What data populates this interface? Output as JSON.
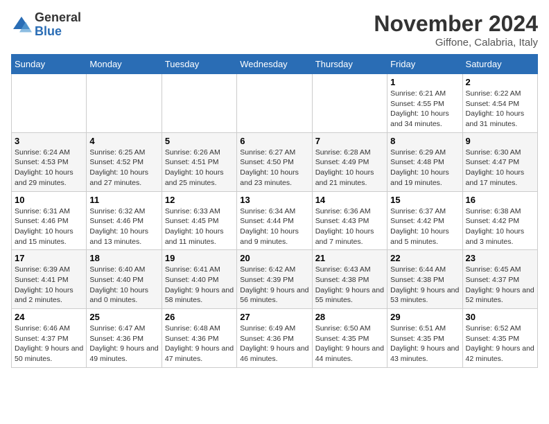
{
  "logo": {
    "general": "General",
    "blue": "Blue"
  },
  "title": "November 2024",
  "location": "Giffone, Calabria, Italy",
  "weekdays": [
    "Sunday",
    "Monday",
    "Tuesday",
    "Wednesday",
    "Thursday",
    "Friday",
    "Saturday"
  ],
  "weeks": [
    [
      {
        "day": "",
        "info": ""
      },
      {
        "day": "",
        "info": ""
      },
      {
        "day": "",
        "info": ""
      },
      {
        "day": "",
        "info": ""
      },
      {
        "day": "",
        "info": ""
      },
      {
        "day": "1",
        "info": "Sunrise: 6:21 AM\nSunset: 4:55 PM\nDaylight: 10 hours and 34 minutes."
      },
      {
        "day": "2",
        "info": "Sunrise: 6:22 AM\nSunset: 4:54 PM\nDaylight: 10 hours and 31 minutes."
      }
    ],
    [
      {
        "day": "3",
        "info": "Sunrise: 6:24 AM\nSunset: 4:53 PM\nDaylight: 10 hours and 29 minutes."
      },
      {
        "day": "4",
        "info": "Sunrise: 6:25 AM\nSunset: 4:52 PM\nDaylight: 10 hours and 27 minutes."
      },
      {
        "day": "5",
        "info": "Sunrise: 6:26 AM\nSunset: 4:51 PM\nDaylight: 10 hours and 25 minutes."
      },
      {
        "day": "6",
        "info": "Sunrise: 6:27 AM\nSunset: 4:50 PM\nDaylight: 10 hours and 23 minutes."
      },
      {
        "day": "7",
        "info": "Sunrise: 6:28 AM\nSunset: 4:49 PM\nDaylight: 10 hours and 21 minutes."
      },
      {
        "day": "8",
        "info": "Sunrise: 6:29 AM\nSunset: 4:48 PM\nDaylight: 10 hours and 19 minutes."
      },
      {
        "day": "9",
        "info": "Sunrise: 6:30 AM\nSunset: 4:47 PM\nDaylight: 10 hours and 17 minutes."
      }
    ],
    [
      {
        "day": "10",
        "info": "Sunrise: 6:31 AM\nSunset: 4:46 PM\nDaylight: 10 hours and 15 minutes."
      },
      {
        "day": "11",
        "info": "Sunrise: 6:32 AM\nSunset: 4:46 PM\nDaylight: 10 hours and 13 minutes."
      },
      {
        "day": "12",
        "info": "Sunrise: 6:33 AM\nSunset: 4:45 PM\nDaylight: 10 hours and 11 minutes."
      },
      {
        "day": "13",
        "info": "Sunrise: 6:34 AM\nSunset: 4:44 PM\nDaylight: 10 hours and 9 minutes."
      },
      {
        "day": "14",
        "info": "Sunrise: 6:36 AM\nSunset: 4:43 PM\nDaylight: 10 hours and 7 minutes."
      },
      {
        "day": "15",
        "info": "Sunrise: 6:37 AM\nSunset: 4:42 PM\nDaylight: 10 hours and 5 minutes."
      },
      {
        "day": "16",
        "info": "Sunrise: 6:38 AM\nSunset: 4:42 PM\nDaylight: 10 hours and 3 minutes."
      }
    ],
    [
      {
        "day": "17",
        "info": "Sunrise: 6:39 AM\nSunset: 4:41 PM\nDaylight: 10 hours and 2 minutes."
      },
      {
        "day": "18",
        "info": "Sunrise: 6:40 AM\nSunset: 4:40 PM\nDaylight: 10 hours and 0 minutes."
      },
      {
        "day": "19",
        "info": "Sunrise: 6:41 AM\nSunset: 4:40 PM\nDaylight: 9 hours and 58 minutes."
      },
      {
        "day": "20",
        "info": "Sunrise: 6:42 AM\nSunset: 4:39 PM\nDaylight: 9 hours and 56 minutes."
      },
      {
        "day": "21",
        "info": "Sunrise: 6:43 AM\nSunset: 4:38 PM\nDaylight: 9 hours and 55 minutes."
      },
      {
        "day": "22",
        "info": "Sunrise: 6:44 AM\nSunset: 4:38 PM\nDaylight: 9 hours and 53 minutes."
      },
      {
        "day": "23",
        "info": "Sunrise: 6:45 AM\nSunset: 4:37 PM\nDaylight: 9 hours and 52 minutes."
      }
    ],
    [
      {
        "day": "24",
        "info": "Sunrise: 6:46 AM\nSunset: 4:37 PM\nDaylight: 9 hours and 50 minutes."
      },
      {
        "day": "25",
        "info": "Sunrise: 6:47 AM\nSunset: 4:36 PM\nDaylight: 9 hours and 49 minutes."
      },
      {
        "day": "26",
        "info": "Sunrise: 6:48 AM\nSunset: 4:36 PM\nDaylight: 9 hours and 47 minutes."
      },
      {
        "day": "27",
        "info": "Sunrise: 6:49 AM\nSunset: 4:36 PM\nDaylight: 9 hours and 46 minutes."
      },
      {
        "day": "28",
        "info": "Sunrise: 6:50 AM\nSunset: 4:35 PM\nDaylight: 9 hours and 44 minutes."
      },
      {
        "day": "29",
        "info": "Sunrise: 6:51 AM\nSunset: 4:35 PM\nDaylight: 9 hours and 43 minutes."
      },
      {
        "day": "30",
        "info": "Sunrise: 6:52 AM\nSunset: 4:35 PM\nDaylight: 9 hours and 42 minutes."
      }
    ]
  ]
}
